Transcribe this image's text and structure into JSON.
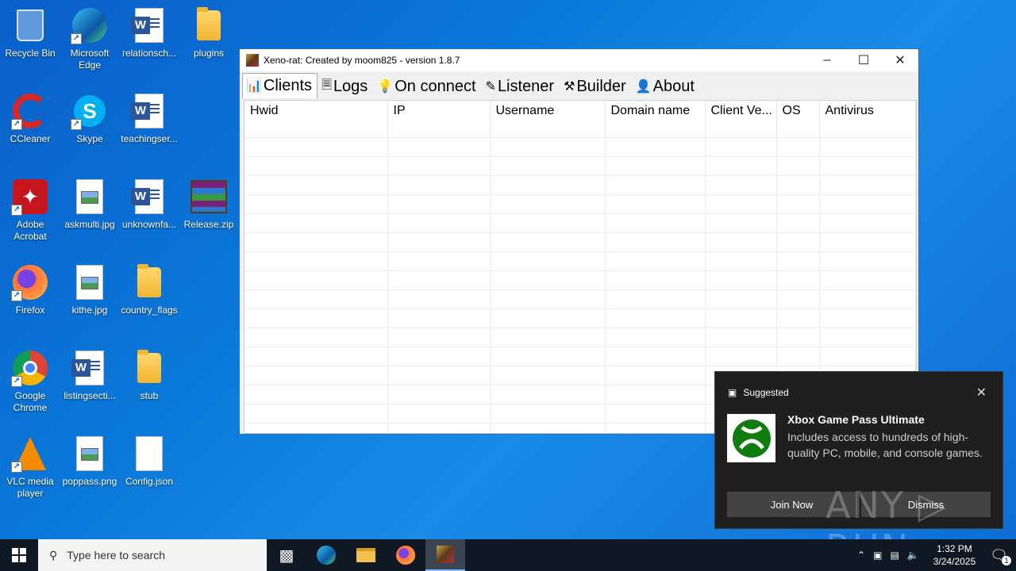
{
  "desktop": {
    "icons": [
      {
        "label": "Recycle Bin",
        "icon": "recycle-bin-icon"
      },
      {
        "label": "Microsoft Edge",
        "icon": "edge-icon"
      },
      {
        "label": "relationsch...",
        "icon": "word-doc-icon"
      },
      {
        "label": "plugins",
        "icon": "folder-icon"
      },
      {
        "label": "CCleaner",
        "icon": "ccleaner-icon"
      },
      {
        "label": "Skype",
        "icon": "skype-icon"
      },
      {
        "label": "teachingser...",
        "icon": "word-doc-icon"
      },
      {
        "label": "Adobe Acrobat",
        "icon": "acrobat-icon"
      },
      {
        "label": "askmulti.jpg",
        "icon": "image-file-icon"
      },
      {
        "label": "unknownfa...",
        "icon": "word-doc-icon"
      },
      {
        "label": "Release.zip",
        "icon": "winrar-archive-icon"
      },
      {
        "label": "Firefox",
        "icon": "firefox-icon"
      },
      {
        "label": "kithe.jpg",
        "icon": "image-file-icon"
      },
      {
        "label": "country_flags",
        "icon": "folder-icon"
      },
      {
        "label": "Google Chrome",
        "icon": "chrome-icon"
      },
      {
        "label": "listingsecti...",
        "icon": "word-doc-icon"
      },
      {
        "label": "stub",
        "icon": "folder-icon"
      },
      {
        "label": "VLC media player",
        "icon": "vlc-icon"
      },
      {
        "label": "poppass.png",
        "icon": "image-file-icon"
      },
      {
        "label": "Config.json",
        "icon": "blank-file-icon"
      }
    ]
  },
  "window": {
    "title": "Xeno-rat: Created by moom825 - version 1.8.7",
    "tabs": [
      {
        "label": "Clients",
        "icon": "bar-chart-icon",
        "glyph": "📊",
        "active": true
      },
      {
        "label": "Logs",
        "icon": "log-icon",
        "glyph": "🗏"
      },
      {
        "label": "On connect",
        "icon": "lightbulb-icon",
        "glyph": "💡"
      },
      {
        "label": "Listener",
        "icon": "pen-icon",
        "glyph": "✎"
      },
      {
        "label": "Builder",
        "icon": "tools-icon",
        "glyph": "⚒"
      },
      {
        "label": "About",
        "icon": "person-icon",
        "glyph": "👤"
      }
    ],
    "columns": [
      "Hwid",
      "IP",
      "Username",
      "Domain name",
      "Client Ve...",
      "OS",
      "Antivirus"
    ]
  },
  "notification": {
    "header": "Suggested",
    "title": "Xbox Game Pass Ultimate",
    "description": "Includes access to hundreds of high-quality PC, mobile, and console games.",
    "primary_button": "Join Now",
    "secondary_button": "Dismiss"
  },
  "watermark": "ANY ▷ RUN",
  "taskbar": {
    "search_placeholder": "Type here to search",
    "time": "1:32 PM",
    "date": "3/24/2025",
    "notification_count": "1"
  }
}
